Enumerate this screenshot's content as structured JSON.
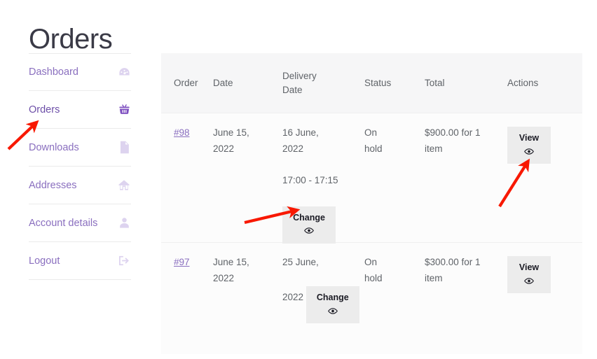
{
  "page": {
    "title": "Orders"
  },
  "sidebar": {
    "items": [
      {
        "label": "Dashboard",
        "icon": "speedometer-icon",
        "active": false
      },
      {
        "label": "Orders",
        "icon": "basket-icon",
        "active": true
      },
      {
        "label": "Downloads",
        "icon": "zip-file-icon",
        "active": false
      },
      {
        "label": "Addresses",
        "icon": "house-icon",
        "active": false
      },
      {
        "label": "Account details",
        "icon": "person-icon",
        "active": false
      },
      {
        "label": "Logout",
        "icon": "sign-out-icon",
        "active": false
      }
    ]
  },
  "table": {
    "headers": {
      "order": "Order",
      "date": "Date",
      "delivery_date_line1": "Delivery",
      "delivery_date_line2": "Date",
      "status": "Status",
      "total": "Total",
      "actions": "Actions"
    },
    "rows": [
      {
        "order": "#98",
        "date_line1": "June 15,",
        "date_line2": "2022",
        "delivery_line1": "16 June,",
        "delivery_line2": "2022",
        "delivery_time": "17:00 - 17:15",
        "status_line1": "On",
        "status_line2": "hold",
        "total_line1": "$900.00 for 1",
        "total_line2": "item",
        "change_label": "Change",
        "view_label": "View"
      },
      {
        "order": "#97",
        "date_line1": "June 15,",
        "date_line2": "2022",
        "delivery_line1": "25 June,",
        "delivery_line2": "2022",
        "delivery_time": "",
        "status_line1": "On",
        "status_line2": "hold",
        "total_line1": "$300.00 for 1",
        "total_line2": "item",
        "change_label": "Change",
        "view_label": "View"
      }
    ]
  },
  "colors": {
    "accent_purple": "#8a6fbf",
    "active_purple": "#7e4fc0",
    "annotation_red": "#f81800",
    "header_bg": "#f6f6f7",
    "button_bg": "#ececec",
    "text_gray": "#5f6368"
  },
  "annotations": {
    "arrows": [
      {
        "name": "arrow-to-orders-nav",
        "points_to": "Orders"
      },
      {
        "name": "arrow-to-change-button",
        "points_to": "Change"
      },
      {
        "name": "arrow-to-view-button",
        "points_to": "View"
      }
    ]
  }
}
